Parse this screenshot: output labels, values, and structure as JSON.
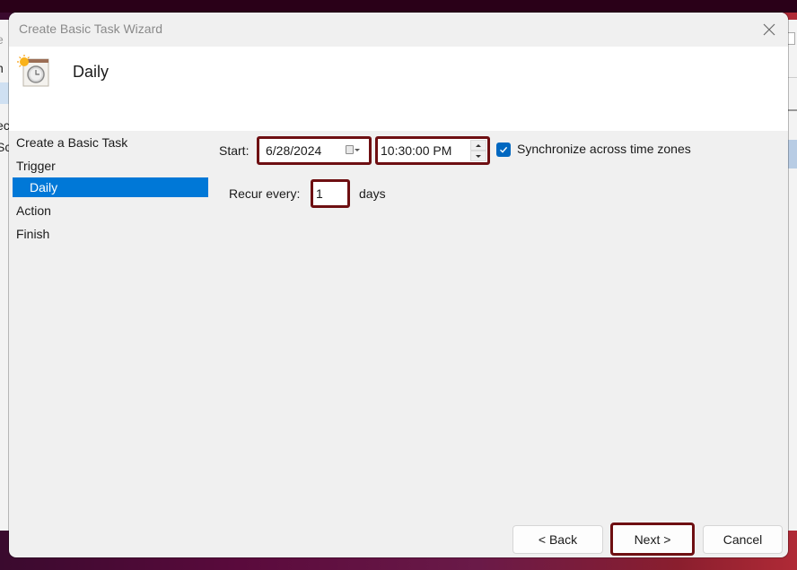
{
  "dialog": {
    "title": "Create Basic Task Wizard",
    "header_title": "Daily",
    "header_icon": "task-scheduler-clock-icon",
    "close_icon": "close-icon"
  },
  "nav": {
    "items": [
      {
        "label": "Create a Basic Task",
        "selected": false,
        "indent": false
      },
      {
        "label": "Trigger",
        "selected": false,
        "indent": false
      },
      {
        "label": "Daily",
        "selected": true,
        "indent": true
      },
      {
        "label": "Action",
        "selected": false,
        "indent": false
      },
      {
        "label": "Finish",
        "selected": false,
        "indent": false
      }
    ]
  },
  "form": {
    "start_label": "Start:",
    "start_date": "6/28/2024",
    "start_time": "10:30:00 PM",
    "sync_label": "Synchronize across time zones",
    "sync_checked": true,
    "recur_label": "Recur every:",
    "recur_value": "1",
    "recur_unit": "days"
  },
  "buttons": {
    "back": "< Back",
    "next": "Next >",
    "cancel": "Cancel"
  },
  "background_app": {
    "fragments": [
      "e",
      "n",
      "ec",
      "Sc"
    ]
  },
  "colors": {
    "selection": "#0078d7",
    "highlight_border": "#6e0f12",
    "checkbox": "#0067c0"
  }
}
